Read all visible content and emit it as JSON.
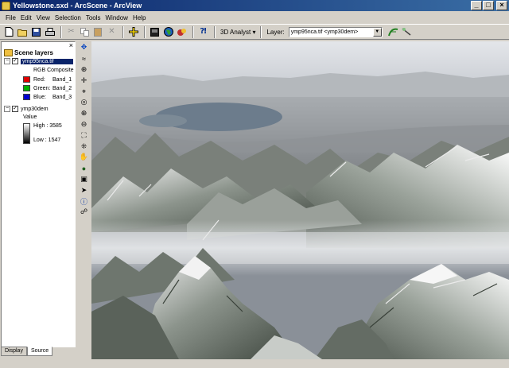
{
  "window": {
    "title": "Yellowstone.sxd - ArcScene - ArcView",
    "minimize": "_",
    "maximize": "□",
    "close": "×"
  },
  "menu": [
    "File",
    "Edit",
    "View",
    "Selection",
    "Tools",
    "Window",
    "Help"
  ],
  "toolbar": {
    "icons": [
      "new-icon",
      "open-icon",
      "save-icon",
      "print-icon",
      "cut-icon",
      "copy-icon",
      "paste-icon",
      "delete-icon",
      "add-data-icon",
      "scene-properties-icon",
      "globe-icon",
      "animation-icon",
      "help-icon"
    ],
    "analyst_label": "3D Analyst ▾",
    "layer_label": "Layer:",
    "layer_value": "ymp95nca.tif <ymp30dem>"
  },
  "toc": {
    "close": "×",
    "root_label": "Scene layers",
    "layers": [
      {
        "name": "ymp95nca.tif",
        "expander": "−",
        "check": "✓",
        "renderer": "RGB Composite",
        "bands": [
          {
            "channel": "Red:",
            "band": "Band_1",
            "color": "#e00000"
          },
          {
            "channel": "Green:",
            "band": "Band_2",
            "color": "#00b000"
          },
          {
            "channel": "Blue:",
            "band": "Band_3",
            "color": "#0000d0"
          }
        ]
      },
      {
        "name": "ymp30dem",
        "expander": "−",
        "check": "✓",
        "value_label": "Value",
        "high": "High : 3585",
        "low": "Low : 1547"
      }
    ],
    "tabs": [
      "Display",
      "Source"
    ],
    "active_tab": "Source"
  },
  "tools": [
    "navigate-icon",
    "fly-icon",
    "zoom-to-target-icon",
    "center-on-target-icon",
    "set-observer-icon",
    "zoom-in-out-icon",
    "zoom-in-icon",
    "zoom-out-icon",
    "full-extent-icon",
    "pan-icon",
    "globe-tool-icon",
    "select-features-icon",
    "select-elements-icon",
    "identify-icon",
    "find-icon"
  ]
}
